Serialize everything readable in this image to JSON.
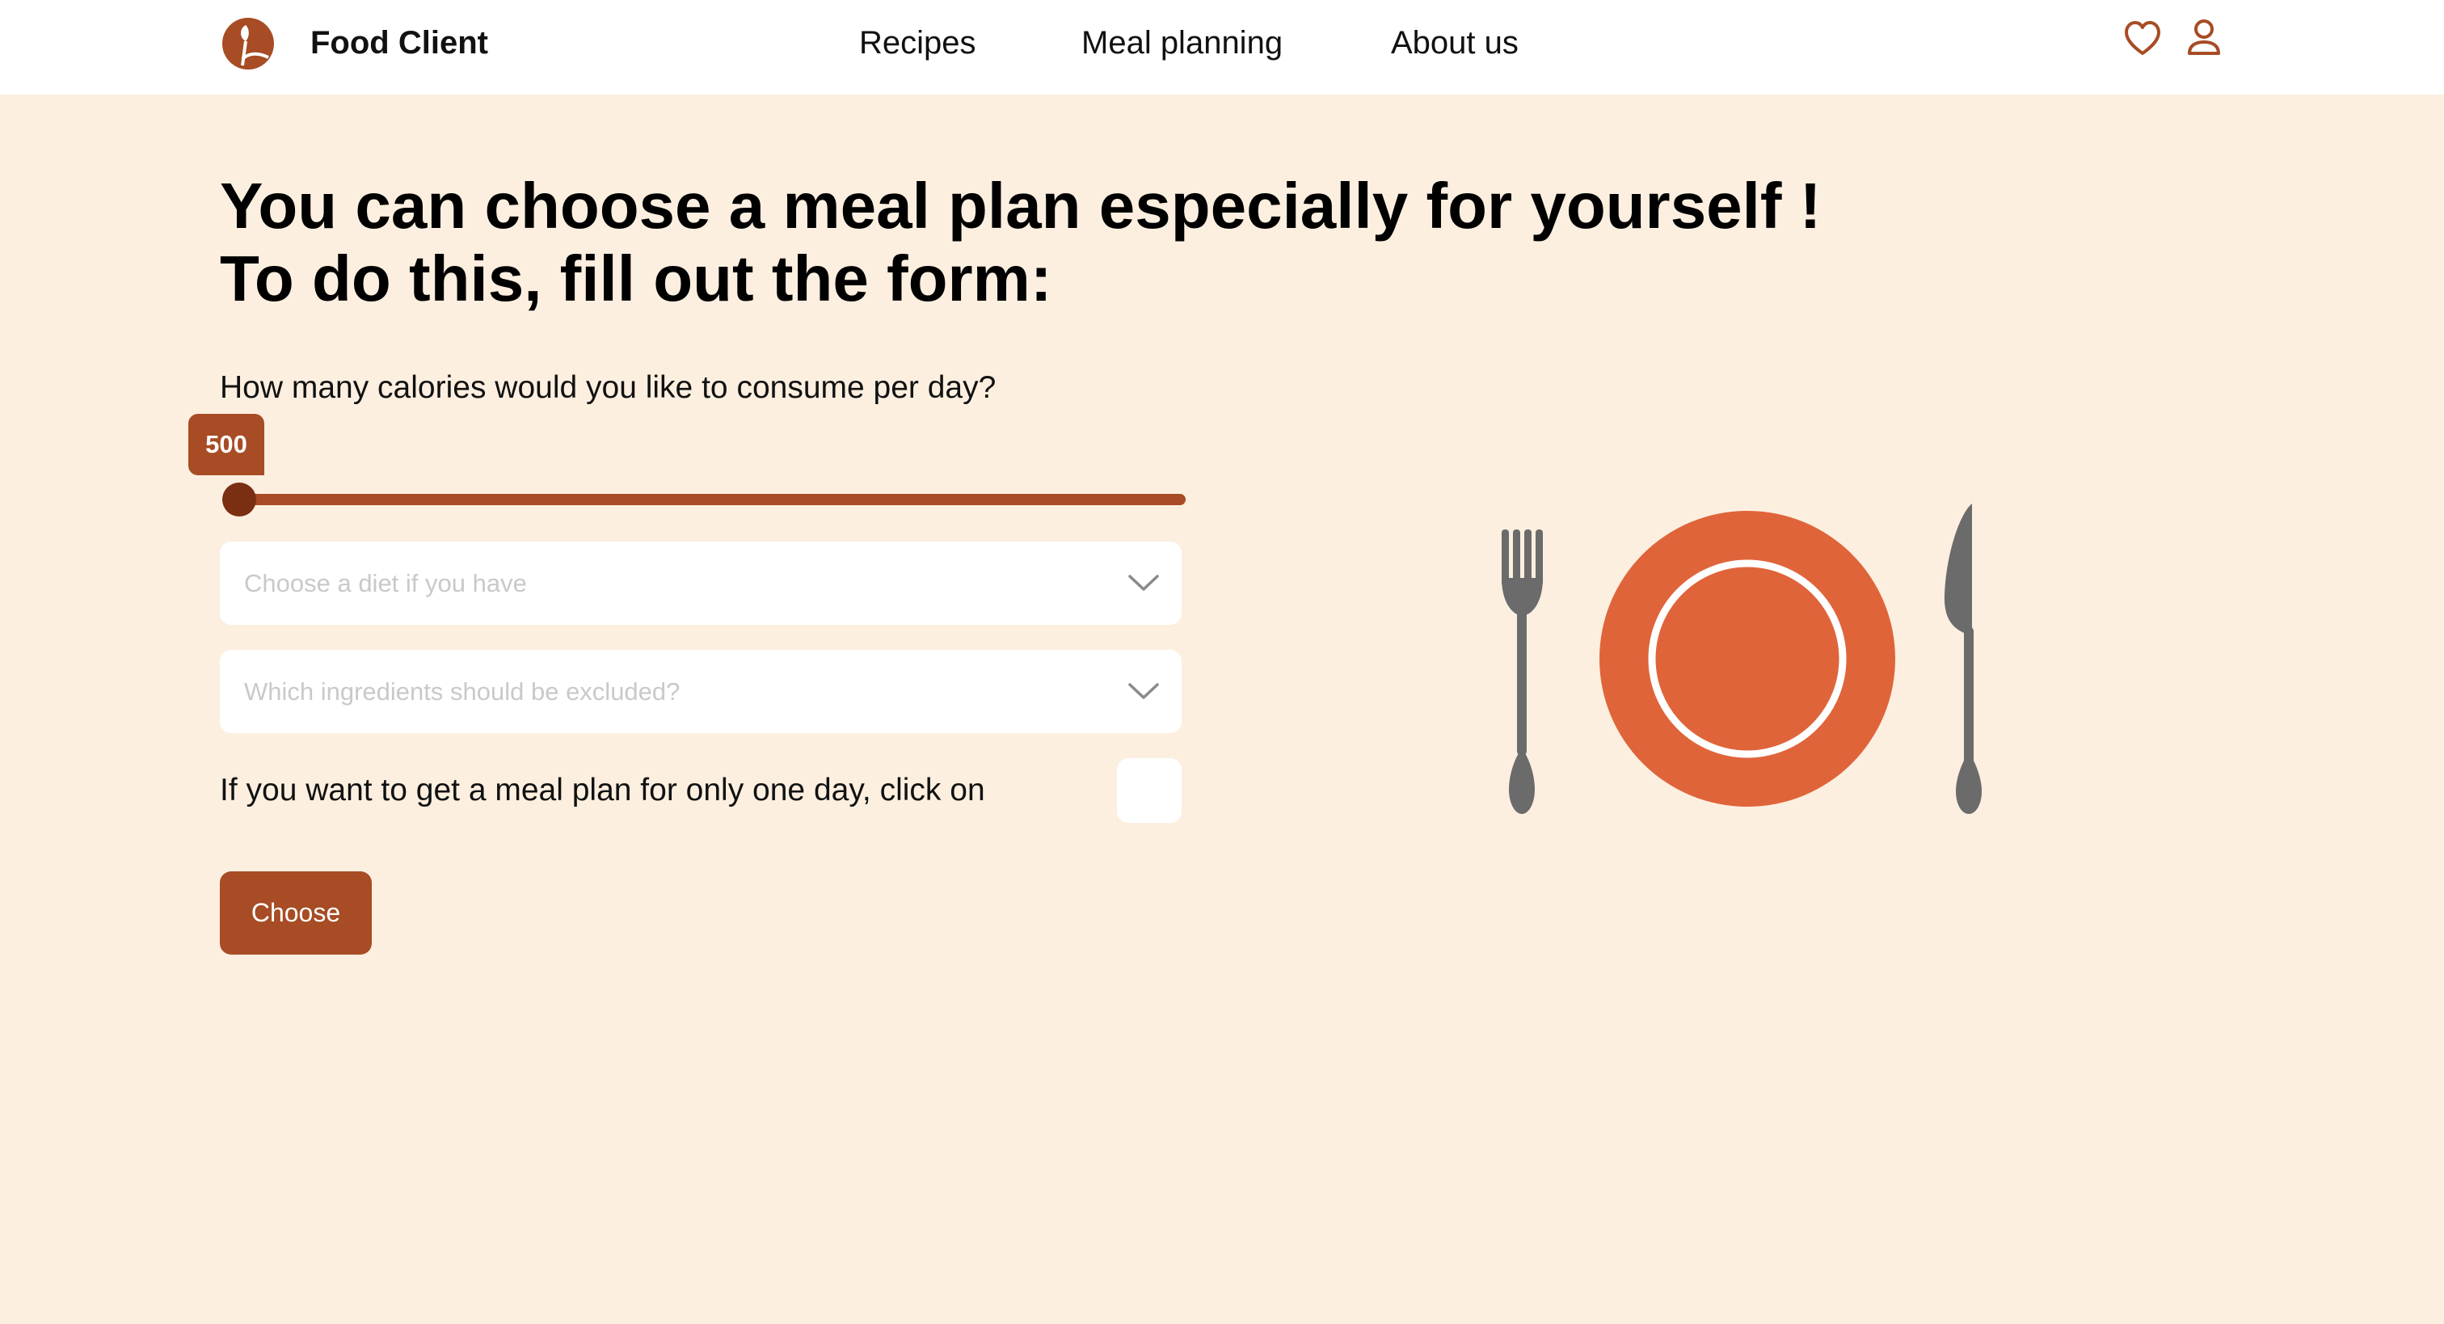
{
  "header": {
    "brand": "Food Client",
    "nav": [
      "Recipes",
      "Meal planning",
      "About us"
    ],
    "icons": [
      "logo-icon",
      "heart-icon",
      "user-icon"
    ]
  },
  "main": {
    "headline_line1": "You can choose a meal plan especially for yourself !",
    "headline_line2": "To do this, fill out the form:",
    "calories_question": "How many calories would you like to consume per day?",
    "calories_value": "500",
    "diet_placeholder": "Choose a diet if you have",
    "ingredients_placeholder": "Which ingredients should be excluded?",
    "one_day_label": "If you want to get a meal plan for only one day, click on",
    "choose_button": "Choose"
  },
  "colors": {
    "accent": "#A74C24",
    "background": "#FCEFE0",
    "plate": "#E0643A",
    "cutlery": "#6B6B6B"
  }
}
